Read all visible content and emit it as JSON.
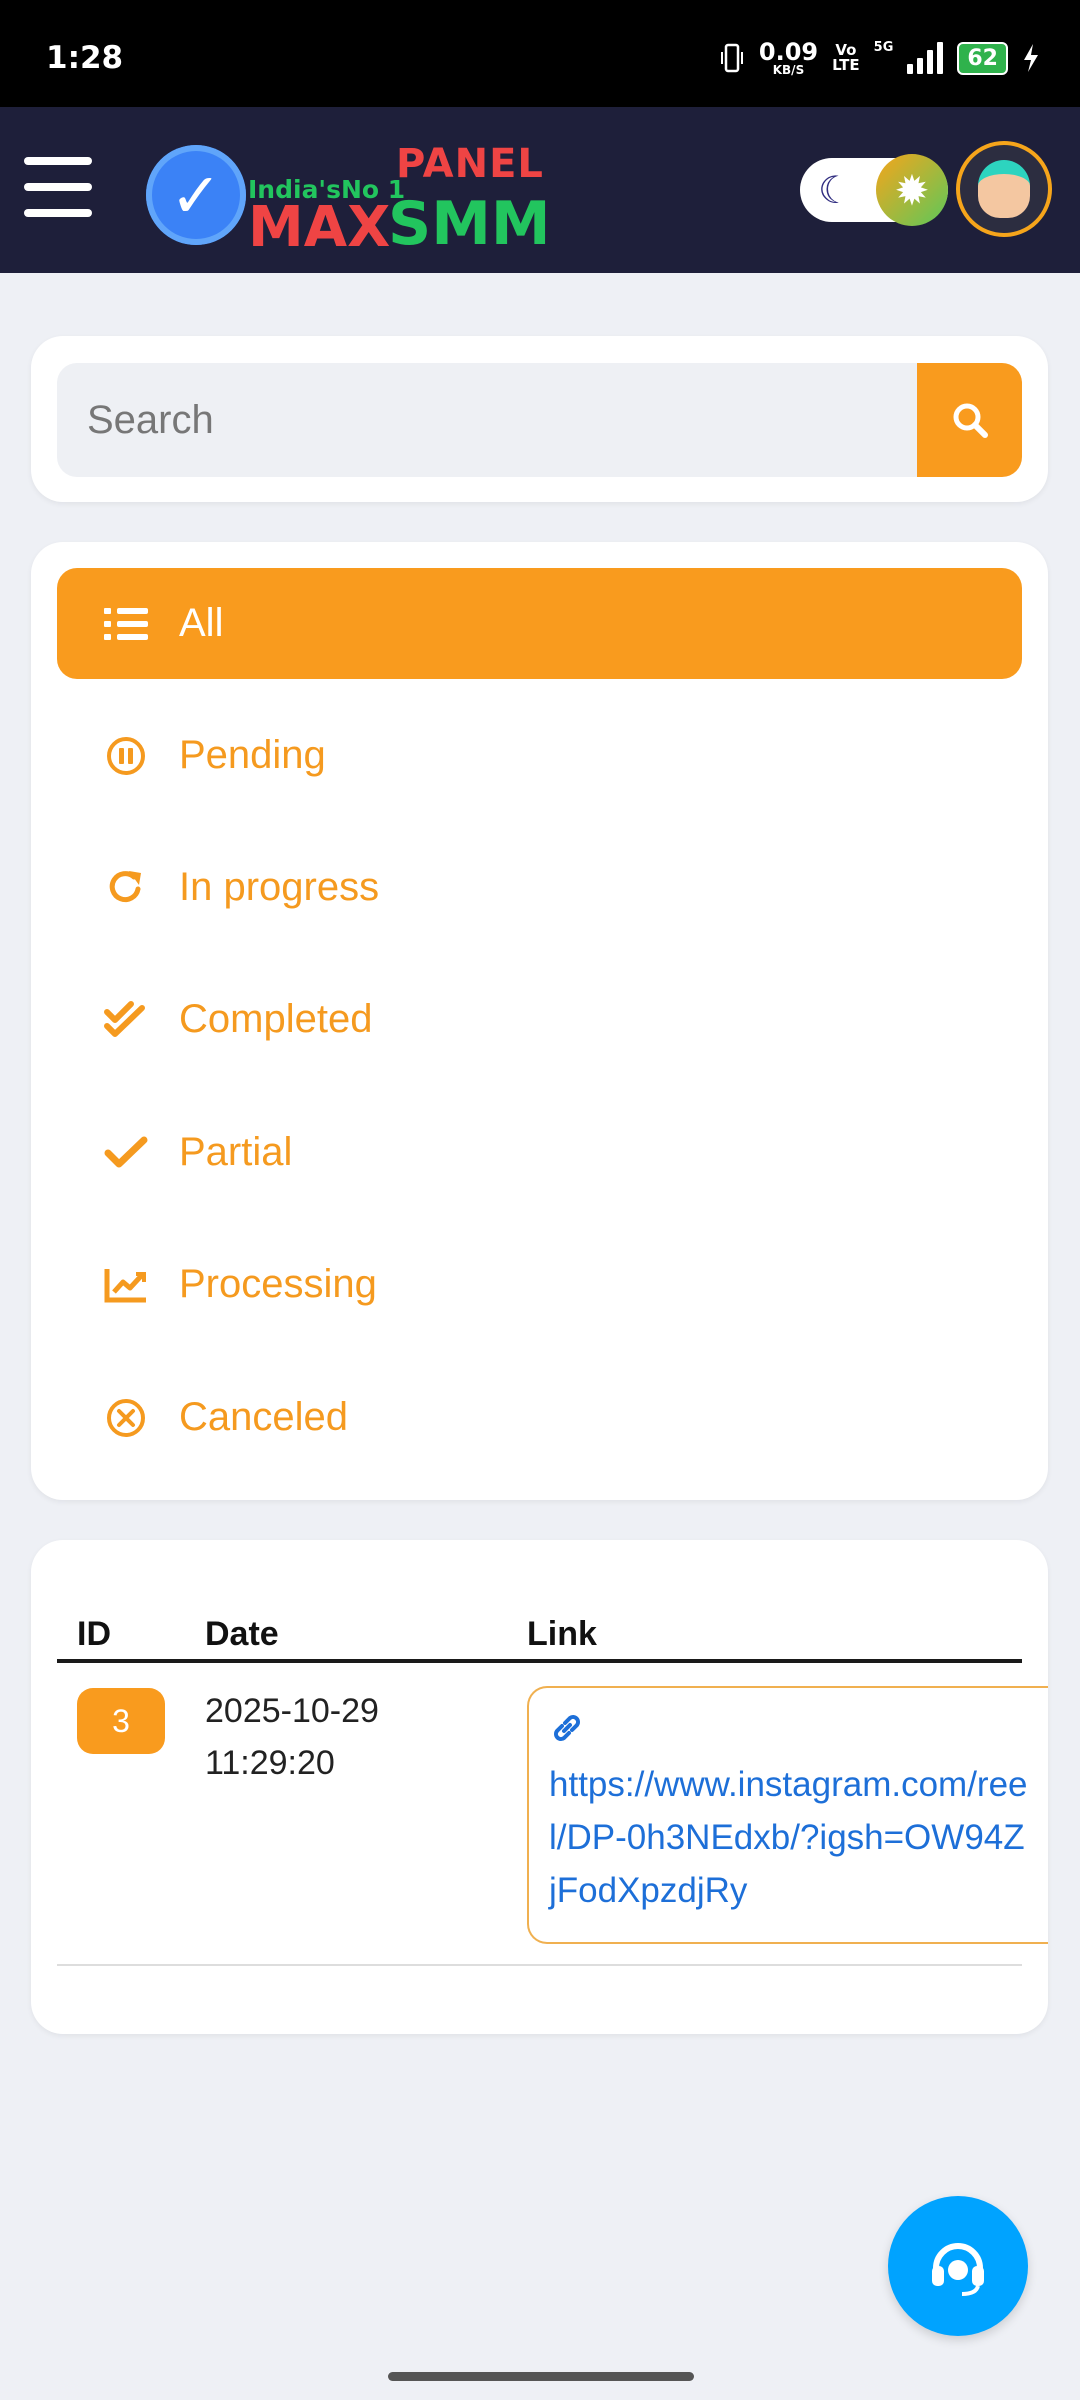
{
  "status_bar": {
    "time": "1:28",
    "net_speed": "0.09",
    "net_unit": "KB/S",
    "lte_top": "Vo",
    "lte_bottom": "LTE",
    "network": "5G",
    "battery": "62"
  },
  "header": {
    "logo_tagline": "India'sNo 1",
    "logo_panel": "PANEL",
    "logo_max": "MAX",
    "logo_smm": "SMM"
  },
  "search": {
    "placeholder": "Search"
  },
  "filters": [
    {
      "label": "All",
      "icon": "list-icon",
      "active": true
    },
    {
      "label": "Pending",
      "icon": "pause-circle-icon",
      "active": false
    },
    {
      "label": "In progress",
      "icon": "refresh-icon",
      "active": false
    },
    {
      "label": "Completed",
      "icon": "double-check-icon",
      "active": false
    },
    {
      "label": "Partial",
      "icon": "check-icon",
      "active": false
    },
    {
      "label": "Processing",
      "icon": "chart-line-icon",
      "active": false
    },
    {
      "label": "Canceled",
      "icon": "x-circle-icon",
      "active": false
    }
  ],
  "table": {
    "headers": {
      "id": "ID",
      "date": "Date",
      "link": "Link"
    },
    "rows": [
      {
        "id": "3",
        "date_line1": "2025-10-29",
        "date_line2": "11:29:20",
        "link": "https://www.instagram.com/reel/DP-0h3NEdxb/?igsh=OW94ZjFodXpzdjRy"
      }
    ]
  },
  "colors": {
    "accent": "#f99b1e",
    "header_bg": "#1e1f3a",
    "link": "#1d6fd8",
    "support": "#00a3ff"
  }
}
